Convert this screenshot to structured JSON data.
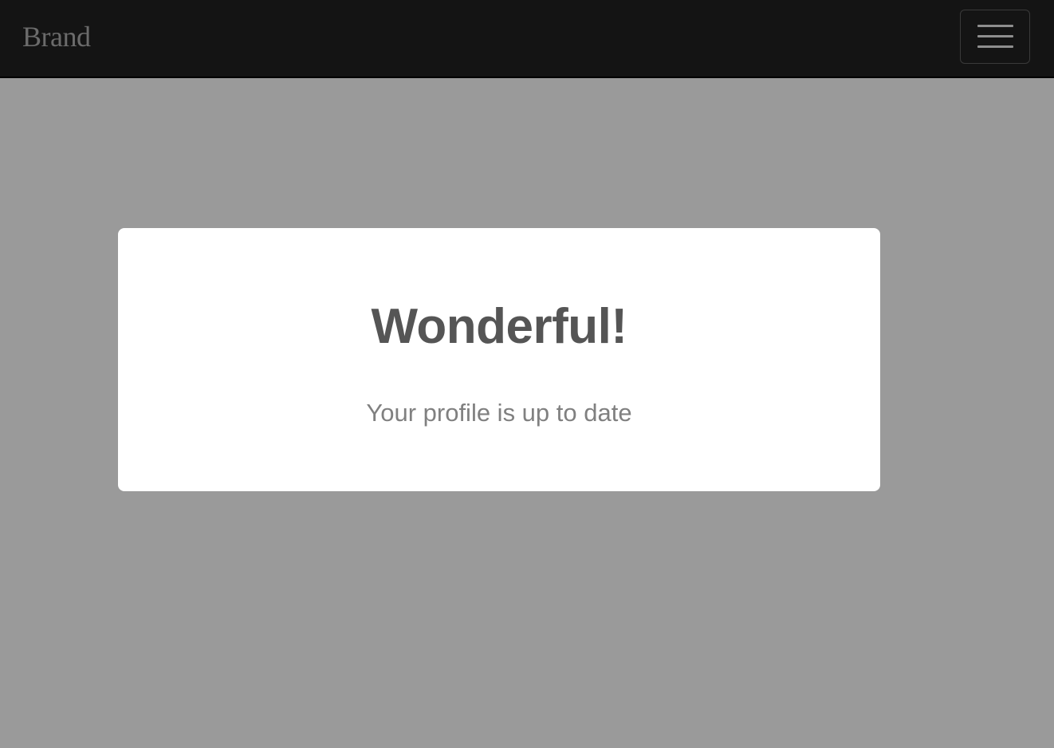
{
  "navbar": {
    "brand": "Brand",
    "menu_toggle_icon": "hamburger-menu-icon"
  },
  "message": {
    "title": "Wonderful!",
    "text": "Your profile is up to date"
  },
  "colors": {
    "navbar_bg": "#141414",
    "page_bg": "#9a9a9a",
    "card_bg": "#ffffff",
    "title": "#555555",
    "text": "#808080",
    "brand": "#6b6b6b"
  }
}
